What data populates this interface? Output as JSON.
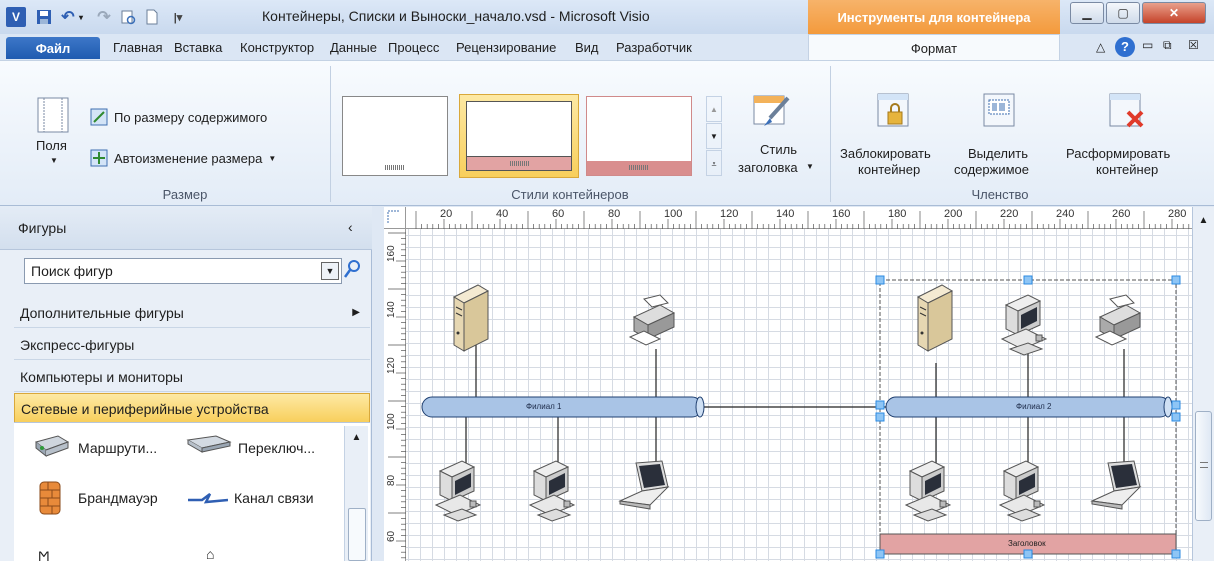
{
  "window": {
    "title": "Контейнеры, Списки и Выноски_начало.vsd - Microsoft Visio",
    "context_title": "Инструменты для контейнера",
    "app_icon": "V"
  },
  "tabs": {
    "file": "Файл",
    "items": [
      "Главная",
      "Вставка",
      "Конструктор",
      "Данные",
      "Процесс",
      "Рецензирование",
      "Вид",
      "Разработчик"
    ],
    "format": "Формат"
  },
  "ribbon": {
    "size_group": {
      "fields": "Поля",
      "fit_to_contents": "По размеру содержимого",
      "auto_resize": "Автоизменение размера",
      "label": "Размер"
    },
    "styles_group": {
      "label": "Стили контейнеров"
    },
    "heading_style": {
      "line1": "Стиль",
      "line2": "заголовка"
    },
    "membership_group": {
      "lock_line1": "Заблокировать",
      "lock_line2": "контейнер",
      "select_line1": "Выделить",
      "select_line2": "содержимое",
      "disband_line1": "Расформировать",
      "disband_line2": "контейнер",
      "label": "Членство"
    }
  },
  "shapes_panel": {
    "title": "Фигуры",
    "search_value": "Поиск фигур",
    "items": [
      "Дополнительные фигуры",
      "Экспресс-фигуры",
      "Компьютеры и мониторы",
      "Сетевые и периферийные устройства"
    ],
    "selected_index": 3,
    "stencil": [
      "Маршрути...",
      "Переключ...",
      "Брандмауэр",
      "Канал связи"
    ]
  },
  "ruler": {
    "top_ticks": [
      "20",
      "40",
      "60",
      "80",
      "100",
      "120",
      "140",
      "160",
      "180",
      "200",
      "220",
      "240",
      "260",
      "280"
    ],
    "left_ticks": [
      "160",
      "140",
      "120",
      "100",
      "80",
      "60"
    ]
  },
  "diagram": {
    "bus1_label": "Филиал 1",
    "bus2_label": "Филиал 2",
    "container_heading": "Заголовок",
    "colors": {
      "bus_fill": "#a9c4e6",
      "heading_fill": "#e2a3a3",
      "selection": "#2b8ae2"
    }
  }
}
